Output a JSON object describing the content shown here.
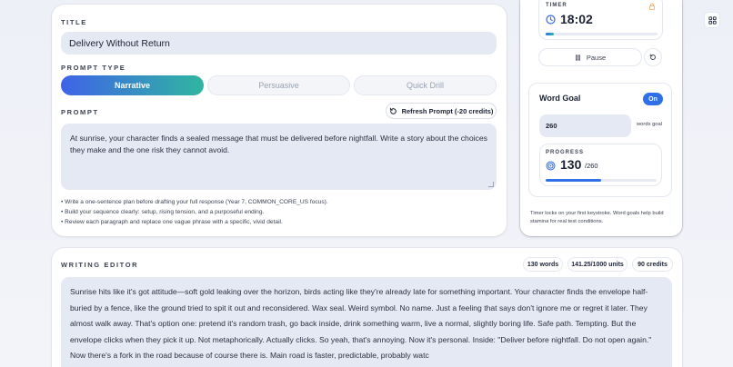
{
  "prompt_card": {
    "title_label": "TITLE",
    "title_value": "Delivery Without Return",
    "prompt_type_label": "PROMPT TYPE",
    "prompt_types": [
      "Narrative",
      "Persuasive",
      "Quick Drill"
    ],
    "active_prompt_type": "Narrative",
    "prompt_label": "PROMPT",
    "refresh_label": "Refresh Prompt (-20 credits)",
    "prompt_text": "At sunrise, your character finds a sealed message that must be delivered before nightfall. Write a story about the choices they make and the one risk they cannot avoid.",
    "tips": [
      "• Write a one-sentence plan before drafting your full response (Year 7, COMMON_CORE_US focus).",
      "• Build your sequence clearly: setup, rising tension, and a purposeful ending.",
      "• Review each paragraph and replace one vague phrase with a specific, vivid detail."
    ]
  },
  "timer": {
    "label": "TIMER",
    "time": "18:02",
    "progress_fraction": 0.07,
    "pause_label": "Pause"
  },
  "word_goal": {
    "title": "Word Goal",
    "toggle_label": "On",
    "goal_value": "260",
    "goal_unit": "words goal",
    "progress_label": "PROGRESS",
    "current": "130",
    "target": "/260",
    "progress_fraction": 0.5,
    "hint": "Timer locks on your first keystroke. Word goals help build stamina for real test conditions."
  },
  "editor": {
    "label": "WRITING EDITOR",
    "chips": [
      "130 words",
      "141.25/1000 units",
      "90 credits"
    ],
    "text": "Sunrise hits like it's got attitude—soft gold leaking over the horizon, birds acting like they're already late for something important. Your character finds the envelope half-buried by a fence, like the ground tried to spit it out and reconsidered. Wax seal. Weird symbol. No name. Just a feeling that says don't ignore me or regret it later. They almost walk away. That's option one: pretend it's random trash, go back inside, drink something warm, live a normal, slightly boring life. Safe path. Tempting. But the envelope clicks when they pick it up. Not metaphorically. Actually clicks. So yeah, that's annoying. Now it's personal. Inside: \"Deliver before nightfall. Do not open again.\" Now there's a fork in the road because of course there is. Main road is faster, predictable, probably watc"
  },
  "colors": {
    "accent_blue": "#2f6fe8",
    "accent_teal": "#30b6a0",
    "field_bg": "#e4e9f3"
  }
}
